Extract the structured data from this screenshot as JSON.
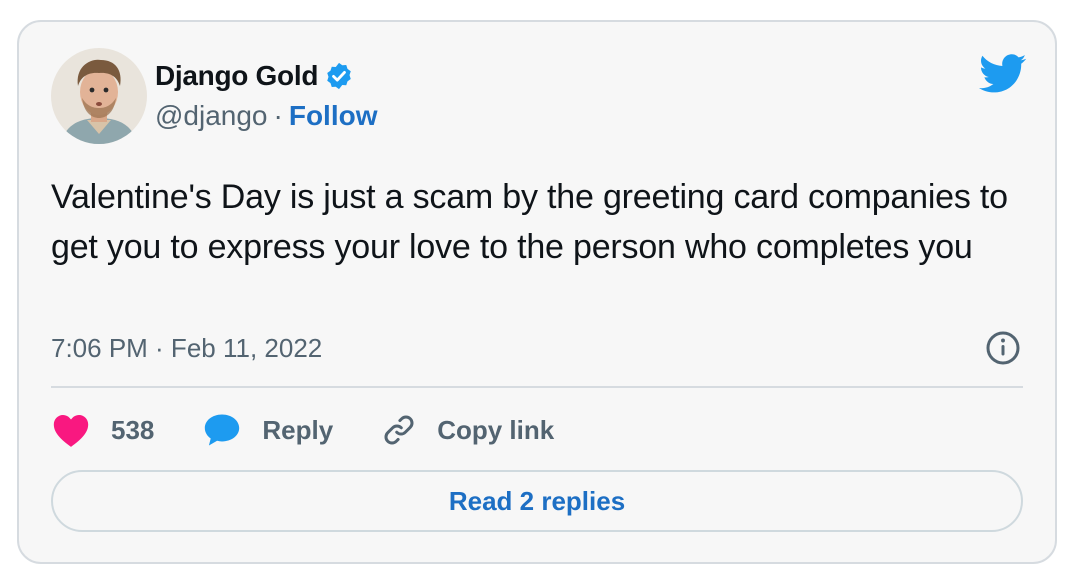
{
  "author": {
    "name": "Django Gold",
    "handle": "@django",
    "separator": "·",
    "follow_label": "Follow",
    "verified": true,
    "avatar": "avatar-photo"
  },
  "tweet": {
    "text": "Valentine's Day is just a scam by the greeting card companies to get you to express your love to the person who completes you",
    "timestamp": "7:06 PM · Feb 11, 2022"
  },
  "actions": {
    "like_count": "538",
    "reply_label": "Reply",
    "copy_link_label": "Copy link"
  },
  "footer": {
    "read_replies_label": "Read 2 replies"
  },
  "icons": {
    "brand": "twitter-bird-icon",
    "verified": "verified-badge-icon",
    "info": "info-icon",
    "like": "heart-icon",
    "reply": "speech-bubble-icon",
    "copy": "link-icon"
  },
  "colors": {
    "accent": "#1d9bf0",
    "link": "#1d6fc4",
    "like": "#f91880",
    "text": "#0f1419",
    "muted": "#536471",
    "card_bg": "#f7f7f7",
    "border": "#d6dbe0"
  }
}
